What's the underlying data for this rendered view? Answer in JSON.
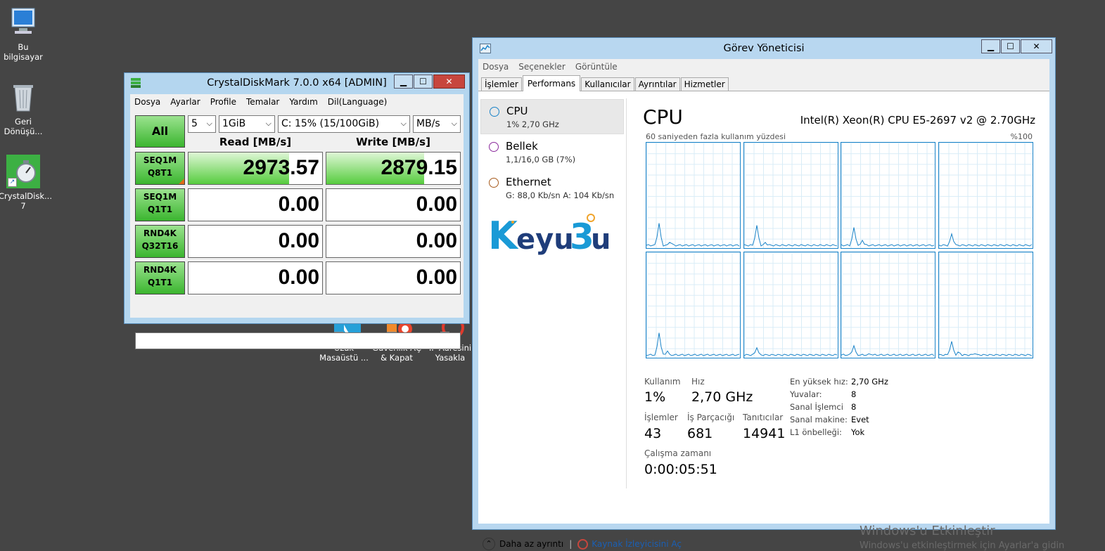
{
  "desktop": {
    "icons": [
      {
        "label": "Bu bilgisayar"
      },
      {
        "label": "Geri Dönüşü..."
      },
      {
        "label": "CrystalDisk... 7"
      },
      {
        "label": "Uzak Masaüstü ..."
      },
      {
        "label": "Güvenlik AÇ & Kapat"
      },
      {
        "label": "IP Adresini Yasakla"
      }
    ],
    "watermark_title": "Windows'u Etkinleştir",
    "watermark_sub": "Windows'u etkinleştirmek için Ayarlar'a gidin"
  },
  "cdm": {
    "title": "CrystalDiskMark 7.0.0 x64 [ADMIN]",
    "menu": [
      "Dosya",
      "Ayarlar",
      "Profile",
      "Temalar",
      "Yardım",
      "Dil(Language)"
    ],
    "all_label": "All",
    "count": "5",
    "size": "1GiB",
    "drive": "C: 15% (15/100GiB)",
    "unit": "MB/s",
    "read_header": "Read [MB/s]",
    "write_header": "Write [MB/s]",
    "rows": [
      {
        "l1": "SEQ1M",
        "l2": "Q8T1",
        "read": "2973.57",
        "write": "2879.15",
        "read_fill": 0.75,
        "write_fill": 0.73
      },
      {
        "l1": "SEQ1M",
        "l2": "Q1T1",
        "read": "0.00",
        "write": "0.00",
        "read_fill": 0,
        "write_fill": 0
      },
      {
        "l1": "RND4K",
        "l2": "Q32T16",
        "read": "0.00",
        "write": "0.00",
        "read_fill": 0,
        "write_fill": 0
      },
      {
        "l1": "RND4K",
        "l2": "Q1T1",
        "read": "0.00",
        "write": "0.00",
        "read_fill": 0,
        "write_fill": 0
      }
    ],
    "status": ""
  },
  "tm": {
    "title": "Görev Yöneticisi",
    "menu": [
      "Dosya",
      "Seçenekler",
      "Görüntüle"
    ],
    "tabs": [
      "İşlemler",
      "Performans",
      "Kullanıcılar",
      "Ayrıntılar",
      "Hizmetler"
    ],
    "active_tab": 1,
    "sidebar": [
      {
        "name": "CPU",
        "sub": "1% 2,70 GHz",
        "color": "#1a83c8"
      },
      {
        "name": "Bellek",
        "sub": "1,1/16,0 GB (7%)",
        "color": "#8b2a9c"
      },
      {
        "name": "Ethernet",
        "sub": "G: 88,0 Kb/sn A: 104 Kb/sn",
        "color": "#a75a1c"
      }
    ],
    "brand": "Keyu3u",
    "panel": {
      "title": "CPU",
      "model": "Intel(R) Xeon(R) CPU E5-2697 v2 @ 2.70GHz",
      "graph_caption": "60 saniyeden fazla kullanım yüzdesi",
      "graph_max": "%100",
      "stats": {
        "usage_label": "Kullanım",
        "usage": "1%",
        "speed_label": "Hız",
        "speed": "2,70 GHz",
        "processes_label": "İşlemler",
        "processes": "43",
        "threads_label": "İş Parçacığı",
        "threads": "681",
        "handles_label": "Tanıtıcılar",
        "handles": "14941",
        "uptime_label": "Çalışma zamanı",
        "uptime": "0:00:05:51"
      },
      "details": [
        {
          "k": "En yüksek hız:",
          "v": "2,70 GHz"
        },
        {
          "k": "Yuvalar:",
          "v": "8"
        },
        {
          "k": "Sanal İşlemci",
          "v": "8"
        },
        {
          "k": "Sanal makine:",
          "v": "Evet"
        },
        {
          "k": "L1 önbelleği:",
          "v": "Yok"
        }
      ]
    },
    "footer": {
      "less_details": "Daha az ayrıntı",
      "resource_monitor": "Kaynak İzleyicisini Aç"
    }
  }
}
